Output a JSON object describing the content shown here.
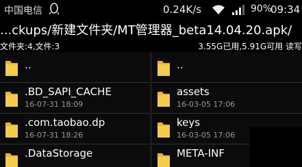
{
  "status_bar": {
    "carrier": "中国电信",
    "speed": "0.24K/s",
    "battery": "90%",
    "time": "09:34"
  },
  "path": "...ckups/新建文件夹/MT管理器_beta14.04.20.apk/",
  "info": {
    "counts": "文件夹:4,文件:3",
    "storage": "3.55G已用,5.91G可用 读写"
  },
  "left_pane": [
    {
      "name": "..",
      "date": ""
    },
    {
      "name": ".BD_SAPI_CACHE",
      "date": "16-07-31 18:09"
    },
    {
      "name": ".com.taobao.dp",
      "date": "16-07-31 18:26"
    },
    {
      "name": ".DataStorage",
      "date": ""
    }
  ],
  "right_pane": [
    {
      "name": "..",
      "date": ""
    },
    {
      "name": "assets",
      "date": "16-03-05 17:06"
    },
    {
      "name": "keys",
      "date": "16-03-05 17:06"
    },
    {
      "name": "META-INF",
      "date": ""
    }
  ],
  "colors": {
    "folder": "#e9b52c",
    "background": "#0b0b0b",
    "date_text": "#9a9a9a"
  },
  "icons": {
    "status": [
      "qq-icon",
      "wifi-icon",
      "signal-icon"
    ],
    "entry": "folder-icon"
  }
}
